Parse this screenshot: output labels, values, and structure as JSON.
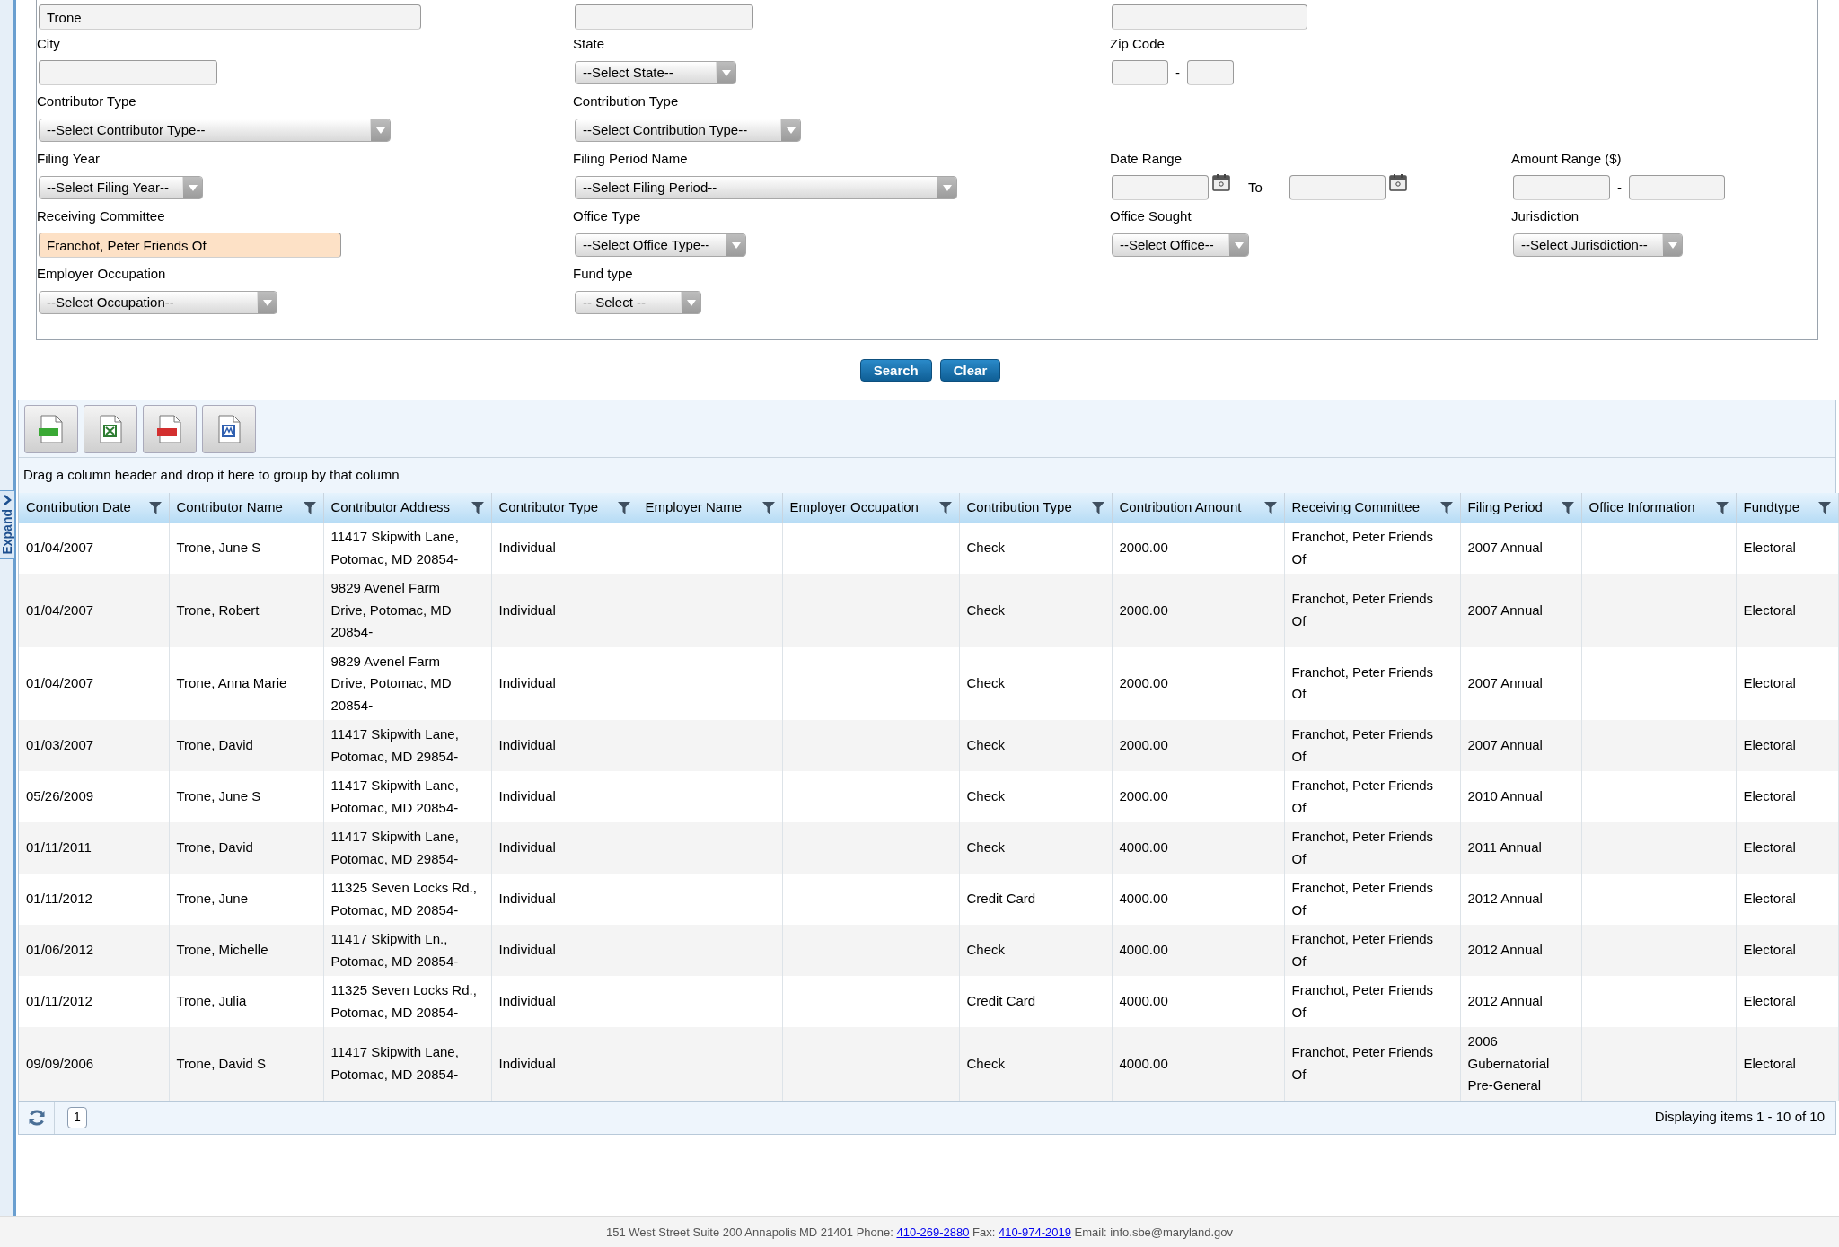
{
  "sidebar_tab": {
    "label": "Expand"
  },
  "form": {
    "rows": [
      [
        {
          "kind": "text",
          "value": "Trone"
        },
        {
          "kind": "text"
        },
        {
          "kind": "text"
        }
      ],
      [
        {
          "kind": "text",
          "label": "City"
        },
        {
          "kind": "select",
          "label": "State",
          "option": "--Select State--"
        },
        {
          "kind": "split",
          "label": "Zip Code",
          "separator": "-"
        }
      ],
      [
        {
          "kind": "select",
          "label": "Contributor Type",
          "option": "--Select Contributor Type--"
        },
        {
          "kind": "select",
          "label": "Contribution Type",
          "option": "--Select Contribution Type--"
        }
      ],
      [
        {
          "kind": "select",
          "label": "Filing Year",
          "option": "--Select Filing Year--"
        },
        {
          "kind": "select",
          "label": "Filing Period Name",
          "option": "--Select Filing Period--"
        },
        {
          "kind": "date_range",
          "label": "Date Range",
          "separator": "To"
        },
        {
          "kind": "split",
          "label": "Amount Range ($)",
          "separator": "-"
        }
      ],
      [
        {
          "kind": "text",
          "label": "Receiving Committee",
          "value": "Franchot, Peter Friends Of",
          "highlighted": true
        },
        {
          "kind": "select",
          "label": "Office Type",
          "option": "--Select Office Type--"
        },
        {
          "kind": "select",
          "label": "Office Sought",
          "option": "--Select Office--"
        },
        {
          "kind": "select",
          "label": "Jurisdiction",
          "option": "--Select Jurisdiction--"
        }
      ],
      [
        {
          "kind": "select",
          "label": "Employer Occupation",
          "option": "--Select Occupation--"
        },
        {
          "kind": "select",
          "label": "Fund type",
          "option": "-- Select --"
        }
      ]
    ]
  },
  "buttons": [
    "Search",
    "Clear"
  ],
  "grid": {
    "group_hint": "Drag a column header and drop it here to group by that column",
    "columns": [
      "Contribution Date",
      "Contributor Name",
      "Contributor Address",
      "Contributor Type",
      "Employer Name",
      "Employer Occupation",
      "Contribution Type",
      "Contribution Amount",
      "Receiving Committee",
      "Filing Period",
      "Office Information",
      "Fundtype"
    ],
    "rows": [
      [
        "01/04/2007",
        "Trone, June S",
        "11417 Skipwith Lane, Potomac, MD 20854-",
        "Individual",
        "",
        "",
        "Check",
        "2000.00",
        "Franchot, Peter Friends Of",
        "2007 Annual",
        "",
        "Electoral"
      ],
      [
        "01/04/2007",
        "Trone, Robert",
        "9829 Avenel Farm Drive, Potomac, MD 20854-",
        "Individual",
        "",
        "",
        "Check",
        "2000.00",
        "Franchot, Peter Friends Of",
        "2007 Annual",
        "",
        "Electoral"
      ],
      [
        "01/04/2007",
        "Trone, Anna Marie",
        "9829 Avenel Farm Drive, Potomac, MD 20854-",
        "Individual",
        "",
        "",
        "Check",
        "2000.00",
        "Franchot, Peter Friends Of",
        "2007 Annual",
        "",
        "Electoral"
      ],
      [
        "01/03/2007",
        "Trone, David",
        "11417 Skipwith Lane, Potomac, MD 29854-",
        "Individual",
        "",
        "",
        "Check",
        "2000.00",
        "Franchot, Peter Friends Of",
        "2007 Annual",
        "",
        "Electoral"
      ],
      [
        "05/26/2009",
        "Trone, June S",
        "11417 Skipwith Lane, Potomac, MD 20854-",
        "Individual",
        "",
        "",
        "Check",
        "2000.00",
        "Franchot, Peter Friends Of",
        "2010 Annual",
        "",
        "Electoral"
      ],
      [
        "01/11/2011",
        "Trone, David",
        "11417 Skipwith Lane, Potomac, MD 29854-",
        "Individual",
        "",
        "",
        "Check",
        "4000.00",
        "Franchot, Peter Friends Of",
        "2011 Annual",
        "",
        "Electoral"
      ],
      [
        "01/11/2012",
        "Trone, June",
        "11325 Seven Locks Rd., Potomac, MD 20854-",
        "Individual",
        "",
        "",
        "Credit Card",
        "4000.00",
        "Franchot, Peter Friends Of",
        "2012 Annual",
        "",
        "Electoral"
      ],
      [
        "01/06/2012",
        "Trone, Michelle",
        "11417 Skipwith Ln., Potomac, MD 20854-",
        "Individual",
        "",
        "",
        "Check",
        "4000.00",
        "Franchot, Peter Friends Of",
        "2012 Annual",
        "",
        "Electoral"
      ],
      [
        "01/11/2012",
        "Trone, Julia",
        "11325 Seven Locks Rd., Potomac, MD 20854-",
        "Individual",
        "",
        "",
        "Credit Card",
        "4000.00",
        "Franchot, Peter Friends Of",
        "2012 Annual",
        "",
        "Electoral"
      ],
      [
        "09/09/2006",
        "Trone, David S",
        "11417 Skipwith Lane, Potomac, MD 20854-",
        "Individual",
        "",
        "",
        "Check",
        "4000.00",
        "Franchot, Peter Friends Of",
        "2006 Gubernatorial Pre-General",
        "",
        "Electoral"
      ]
    ],
    "pager": {
      "pages": [
        {
          "label": "1",
          "selected": true
        }
      ],
      "status": "Displaying items 1 - 10 of 10"
    }
  },
  "footer": {
    "parts": [
      {
        "kind": "text",
        "text": "151 West Street Suite 200 Annapolis MD 21401 Phone:"
      },
      {
        "kind": "link",
        "text": "410-269-2880"
      },
      {
        "kind": "text",
        "text": "Fax:"
      },
      {
        "kind": "link",
        "text": "410-974-2019"
      },
      {
        "kind": "text",
        "text": "Email: info.sbe@maryland.gov"
      }
    ]
  }
}
